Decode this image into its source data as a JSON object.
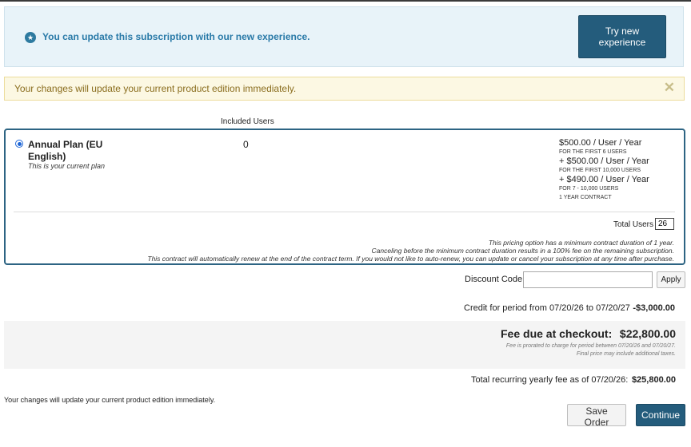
{
  "info_banner": {
    "text": "You can update this subscription with our new experience.",
    "button_label": "Try new experience",
    "icon": "star-circle-icon"
  },
  "warning_banner": {
    "text": "Your changes will update your current product edition immediately.",
    "close_glyph": "✕"
  },
  "table": {
    "column_included_users": "Included Users"
  },
  "plan": {
    "name": "Annual Plan (EU English)",
    "subtitle": "This is your current plan",
    "included_users": "0",
    "pricing": [
      {
        "price": "$500.00 / User / Year",
        "note": "FOR THE FIRST 6 USERS"
      },
      {
        "price": "+ $500.00 / User / Year",
        "note": "FOR THE FIRST 10,000 USERS"
      },
      {
        "price": "+ $490.00 / User / Year",
        "note": "FOR 7 - 10,000 USERS"
      }
    ],
    "contract": "1 YEAR CONTRACT",
    "total_users_label": "Total Users",
    "total_users_value": "26",
    "terms": [
      "This pricing option has a minimum contract duration of 1 year.",
      "Canceling before the minimum contract duration results in a 100% fee on the remaining subscription.",
      "This contract will automatically renew at the end of the contract term. If you would not like to auto-renew, you can update or cancel your subscription at any time after purchase."
    ]
  },
  "discount": {
    "label": "Discount Code:",
    "value": "",
    "apply_label": "Apply"
  },
  "credit": {
    "label": "Credit for period from 07/20/26 to 07/20/27",
    "value": "-$3,000.00"
  },
  "fee": {
    "label": "Fee due at checkout:",
    "value": "$22,800.00",
    "note1": "Fee is prorated to charge for period between 07/20/26 and 07/20/27.",
    "note2": "Final price may include additional taxes."
  },
  "recurring": {
    "label": "Total recurring yearly fee as of 07/20/26:",
    "value": "$25,800.00"
  },
  "footer": {
    "note": "Your changes will update your current product edition immediately.",
    "save_label": "Save Order",
    "continue_label": "Continue"
  },
  "colors": {
    "primary": "#245c7c",
    "info_text": "#2a7aa8",
    "warning_text": "#8a6d1e",
    "radio": "#1e66d6"
  }
}
